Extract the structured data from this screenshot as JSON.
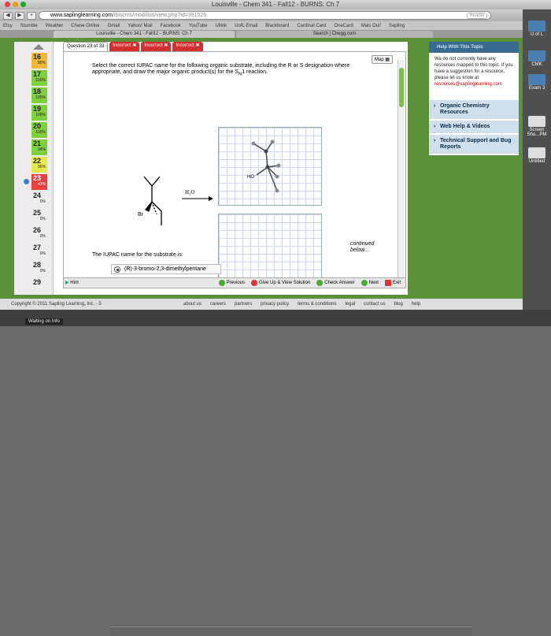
{
  "window": {
    "title": "Louisville - Chem 341 - Fall12 - BURNS: Ch 7"
  },
  "browser": {
    "url_domain": "www.saplinglearning.com",
    "url_path": "/ibiscms/mod/ibis/view.php?id=391526",
    "reader_label": "Reader"
  },
  "bookmarks": [
    "Etsy",
    "Stumble",
    "Weather",
    "Chase Online",
    "Gmail",
    "Yahoo! Mail",
    "Facebook",
    "YouTube",
    "Ullink",
    "UofL Email",
    "Blackboard",
    "Cardinal Card",
    "OneCard",
    "Mais Oui!",
    "Sapling"
  ],
  "tabs": [
    {
      "label": "Louisville - Chem 341 - Fall12 - BURNS: Ch 7"
    },
    {
      "label": "Search | Chegg.com"
    }
  ],
  "desktop_icons": [
    {
      "label": "U of L"
    },
    {
      "label": "CMK"
    },
    {
      "label": "Exam 3"
    },
    {
      "label": "Screen Sho...PM"
    },
    {
      "label": "Untitled"
    }
  ],
  "question_nav": [
    {
      "num": "16",
      "pct": "80%",
      "color": "orange"
    },
    {
      "num": "17",
      "pct": "100%",
      "color": "green"
    },
    {
      "num": "18",
      "pct": "100%",
      "color": "green"
    },
    {
      "num": "19",
      "pct": "100%",
      "color": "green"
    },
    {
      "num": "20",
      "pct": "100%",
      "color": "green"
    },
    {
      "num": "21",
      "pct": "94%",
      "color": "green"
    },
    {
      "num": "22",
      "pct": "95%",
      "color": "yellow"
    },
    {
      "num": "23",
      "pct": "43%",
      "color": "red"
    },
    {
      "num": "24",
      "pct": "0%",
      "color": "none"
    },
    {
      "num": "25",
      "pct": "0%",
      "color": "none"
    },
    {
      "num": "26",
      "pct": "0%",
      "color": "none"
    },
    {
      "num": "27",
      "pct": "0%",
      "color": "none"
    },
    {
      "num": "28",
      "pct": "0%",
      "color": "none"
    },
    {
      "num": "29",
      "pct": "",
      "color": "none"
    }
  ],
  "question_tabs": {
    "current": "Question 23 of 33",
    "attempts": [
      "Incorrect",
      "Incorrect",
      "Incorrect"
    ]
  },
  "question": {
    "map_label": "Map",
    "prompt_line1": "Select the correct IUPAC name for the following organic substrate, including the R or S designation where",
    "prompt_line2": "appropriate, and draw the major organic product(s) for the S",
    "prompt_sub": "N",
    "prompt_end": "1 reaction.",
    "reagent": "H₂O",
    "br_label": "Br",
    "ho_label": "HO",
    "continued": "continued",
    "below": "below...",
    "iupac_label": "The IUPAC name for the substrate is:",
    "selected_option": "(R)-3-bromo-2,3-dimethylpentane"
  },
  "bottom_bar": {
    "hint": "Hint",
    "previous": "Previous",
    "give_up": "Give Up & View Solution",
    "check": "Check Answer",
    "next": "Next",
    "exit": "Exit"
  },
  "sidebar": {
    "head": "Help With This Topic",
    "text": "We do not currently have any resources mapped to this topic. If you have a suggestion for a resource, please let us know at",
    "email": "resources@saplinglearning.com",
    "links": [
      "Organic Chemistry Resources",
      "Web Help & Videos",
      "Technical Support and Bug Reports"
    ]
  },
  "footer": {
    "copyright": "Copyright © 2011 Sapling Learning, Inc. - 5",
    "links": [
      "about us",
      "careers",
      "partners",
      "privacy policy",
      "terms & conditions",
      "legal",
      "contact us",
      "blog",
      "help"
    ]
  },
  "status": {
    "waiting": "Waiting on Info"
  }
}
